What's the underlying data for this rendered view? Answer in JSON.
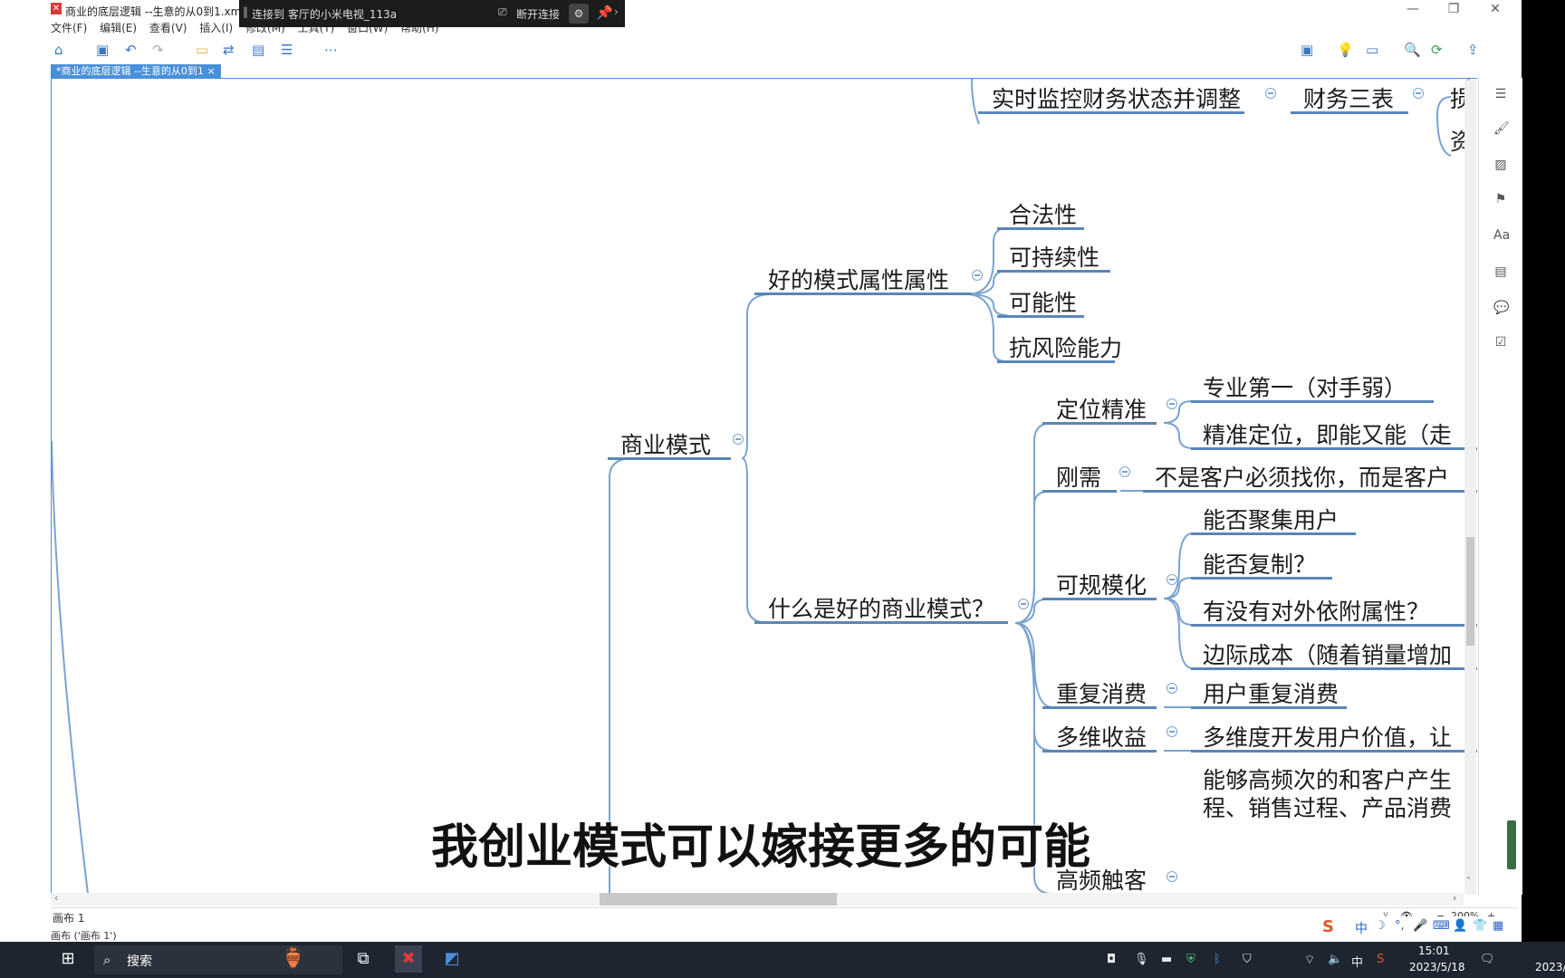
{
  "window": {
    "title": "商业的底层逻辑 --生意的从0到1.xmi",
    "controls": [
      "—",
      "❐",
      "✕"
    ]
  },
  "remote": {
    "connection": "连接到 客厅的小米电视_113a",
    "disconnect_label": "断开连接"
  },
  "menu": [
    "文件(F)",
    "编辑(E)",
    "查看(V)",
    "插入(I)",
    "修改(M)",
    "工具(T)",
    "窗口(W)",
    "帮助(H)"
  ],
  "tab": {
    "label": "*商业的底层逻辑 --生意的从0到1",
    "close": "×"
  },
  "mindmap": {
    "finance_left": "实时监控财务状态并调整",
    "finance_mid": "财务三表",
    "finance_r1": "损",
    "finance_r2": "资",
    "good_attr": "好的模式属性属性",
    "attr_items": [
      "合法性",
      "可持续性",
      "可能性",
      "抗风险能力"
    ],
    "business_model": "商业模式",
    "what_good": "什么是好的商业模式？",
    "positioning": "定位精准",
    "pos_items": [
      "专业第一（对手弱）",
      "精准定位，即能又能（走"
    ],
    "rigid": "刚需",
    "rigid_detail": "不是客户必须找你，而是客户",
    "scalable": "可规模化",
    "scale_items": [
      "能否聚集用户",
      "能否复制？",
      "有没有对外依附属性？",
      "边际成本（随着销量增加"
    ],
    "repeat": "重复消费",
    "repeat_detail": "用户重复消费",
    "multi": "多维收益",
    "multi_detail": "多维度开发用户价值，让",
    "freq": "高频触客",
    "freq_detail_1": "能够高频次的和客户产生",
    "freq_detail_2": "程、销售过程、产品消费"
  },
  "subtitle": "我创业模式可以嫁接更多的可能",
  "sheet": {
    "name": "画布 1",
    "status": "画布 ('画布 1')",
    "zoom": "200%"
  },
  "taskbar": {
    "search_label": "搜索",
    "ime": "中",
    "time": "15:01",
    "date": "2023/5/18",
    "date_edge": "2023/"
  },
  "colors": {
    "accent": "#4a90d9",
    "branch": "#5b86b8",
    "taskbar": "#1e2530"
  }
}
